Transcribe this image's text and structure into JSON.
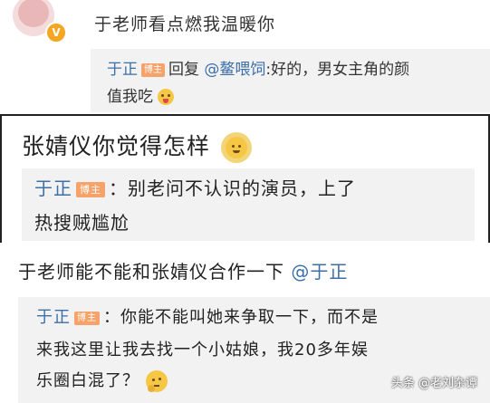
{
  "block1": {
    "comment": "于老师看点燃我温暖你",
    "reply": {
      "user": "于正",
      "badge": "博主",
      "verb": "回复",
      "mention": "@鳌喂饲",
      "text_line1": ":好的，男女主角的颜",
      "text_line2": "值我吃"
    }
  },
  "block2": {
    "comment": "张婧仪你觉得怎样",
    "reply": {
      "user": "于正",
      "badge": "博主",
      "text_line1": "：别老问不认识的演员，上了",
      "text_line2": "热搜贼尴尬"
    }
  },
  "block3": {
    "comment_prefix": "于老师能不能和张婧仪合作一下",
    "comment_mention": "@于正",
    "reply": {
      "user": "于正",
      "badge": "博主",
      "text_line1": "：你能不能叫她来争取一下，而不是",
      "text_line2": "来我这里让我去找一个小姑娘，我20多年娱",
      "text_line3": "乐圈白混了？"
    }
  },
  "watermark": "头条 @老刘杂谭",
  "icons": {
    "verified": "verified-v-icon",
    "emoji1": "tongue-out-emoji",
    "emoji2": "sun-emoji",
    "emoji3": "thinking-emoji"
  },
  "colors": {
    "username": "#3d6fa8",
    "badge": "#f5a36a",
    "reply_bg": "#f2f2f2"
  }
}
